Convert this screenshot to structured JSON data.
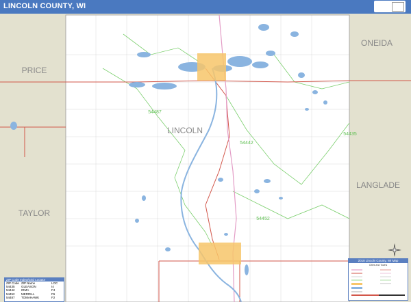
{
  "header": {
    "title": "LINCOLN COUNTY, WI"
  },
  "map_labels": {
    "county": "LINCOLN",
    "neighbors": {
      "west_top": "PRICE",
      "west_bottom": "TAYLOR",
      "east_top": "ONEIDA",
      "east_bottom": "LANGLADE"
    },
    "zip_zones": [
      "54487",
      "54442",
      "54435",
      "54452"
    ]
  },
  "legend_table": {
    "title": "ZIP Code Index/Grid Locator",
    "columns": [
      "ZIP Code",
      "ZIP Name",
      "LOC"
    ],
    "rows": [
      [
        "54435",
        "GLEASON",
        "I4"
      ],
      [
        "54442",
        "IRMA",
        "F4"
      ],
      [
        "54452",
        "MERRILL",
        "F6"
      ],
      [
        "54487",
        "TOMAHAWK",
        "F2"
      ]
    ]
  },
  "legend_box": {
    "title": "2018 Lincoln County, WI Map",
    "subtitle": "Cities and Towns"
  },
  "colors": {
    "header": "#4a79c0",
    "water": "#8ab4e0",
    "urban": "#f7c66a",
    "neighbor": "#e3e1cf",
    "zip_boundary": "#7ccf6e",
    "major_road": "#d2564a",
    "highway": "#e39cc6"
  },
  "icons": [
    "compass-rose-icon"
  ]
}
